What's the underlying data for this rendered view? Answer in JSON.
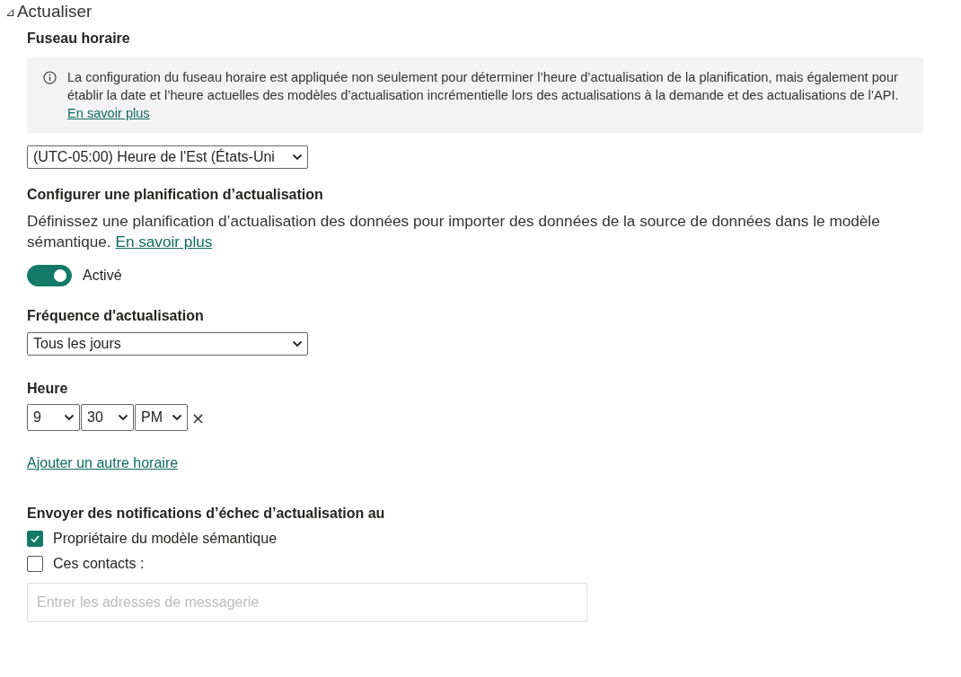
{
  "section": {
    "toggle_glyph": "⊿",
    "title": "Actualiser",
    "expanded": true
  },
  "time_zone": {
    "heading": "Fuseau horaire",
    "info": {
      "text": "La configuration du fuseau horaire est appliquée non seulement pour déterminer l’heure d’actualisation de la planification, mais également pour établir la date et l’heure actuelles des modèles d’actualisation incrémentielle lors des actualisations à la demande et des actualisations de l’API.",
      "link": "En savoir plus"
    },
    "select": {
      "value": "(UTC-05:00) Heure de l'Est (États-Uni"
    }
  },
  "schedule": {
    "heading": "Configurer une planification d’actualisation",
    "description": "Définissez une planification d’actualisation des données pour importer des données de la source de données dans le modèle sémantique.",
    "link": "En savoir plus",
    "toggle": {
      "label": "Activé",
      "on": true
    }
  },
  "frequency": {
    "heading": "Fréquence d'actualisation",
    "select": {
      "value": "Tous les jours"
    }
  },
  "time": {
    "heading": "Heure",
    "selects": [
      {
        "value": "9"
      },
      {
        "value": "30"
      },
      {
        "value": "PM"
      }
    ],
    "remove": "×",
    "add_link": "Ajouter un autre horaire"
  },
  "notifications": {
    "heading": "Envoyer des notifications d’échec d’actualisation au",
    "options": [
      {
        "label": "Propriétaire du modèle sémantique",
        "checked": true
      },
      {
        "label": "Ces contacts :",
        "checked": false
      }
    ],
    "email_field": {
      "placeholder": "Entrer les adresses de messagerie"
    }
  }
}
